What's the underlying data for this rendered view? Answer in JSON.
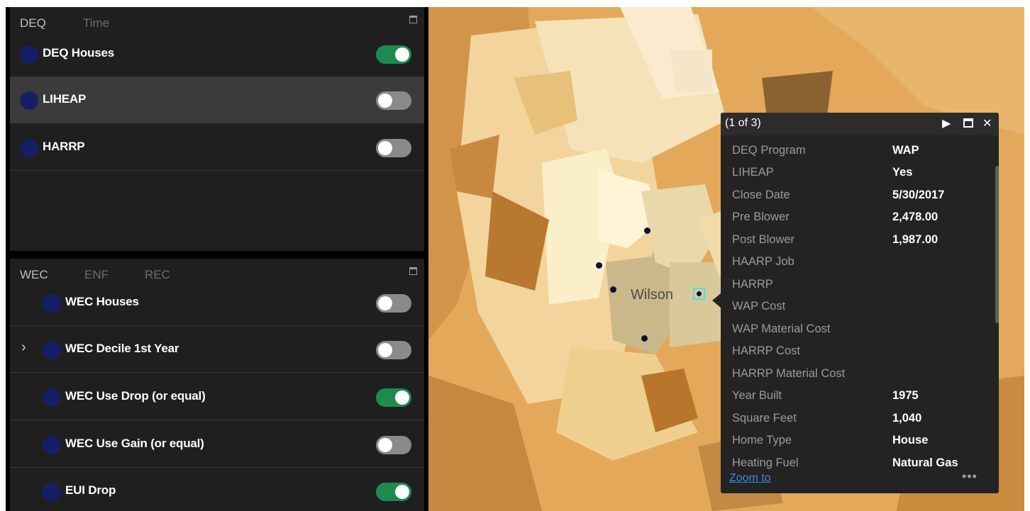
{
  "deq_panel": {
    "tabs": [
      "DEQ",
      "Time"
    ],
    "layers": [
      {
        "label": "DEQ Houses",
        "on": true
      },
      {
        "label": "LIHEAP",
        "on": false
      },
      {
        "label": "HARRP",
        "on": false
      }
    ]
  },
  "wec_panel": {
    "tabs": [
      "WEC",
      "ENF",
      "REC"
    ],
    "layers": [
      {
        "label": "WEC Houses",
        "on": false
      },
      {
        "label": "WEC Decile 1st Year",
        "on": false
      },
      {
        "label": "WEC Use Drop (or equal)",
        "on": true
      },
      {
        "label": "WEC Use Gain (or equal)",
        "on": false
      },
      {
        "label": "EUI Drop",
        "on": true
      }
    ]
  },
  "map": {
    "city_label": "Wilson"
  },
  "popup": {
    "title": "(1 of 3)",
    "next_glyph": "▶",
    "close_glyph": "✕",
    "fields": [
      {
        "name": "DEQ Program",
        "value": "WAP"
      },
      {
        "name": "LIHEAP",
        "value": "Yes"
      },
      {
        "name": "Close Date",
        "value": "5/30/2017"
      },
      {
        "name": "Pre Blower",
        "value": "2,478.00"
      },
      {
        "name": "Post Blower",
        "value": "1,987.00"
      },
      {
        "name": "HAARP Job",
        "value": ""
      },
      {
        "name": "HARRP",
        "value": ""
      },
      {
        "name": "WAP Cost",
        "value": ""
      },
      {
        "name": "WAP Material Cost",
        "value": ""
      },
      {
        "name": "HARRP Cost",
        "value": ""
      },
      {
        "name": "HARRP Material Cost",
        "value": ""
      },
      {
        "name": "Year Built",
        "value": "1975"
      },
      {
        "name": "Square Feet",
        "value": "1,040"
      },
      {
        "name": "Home Type",
        "value": "House"
      },
      {
        "name": "Heating Fuel",
        "value": "Natural Gas"
      }
    ],
    "zoom_link": "Zoom to",
    "more_glyph": "•••"
  }
}
